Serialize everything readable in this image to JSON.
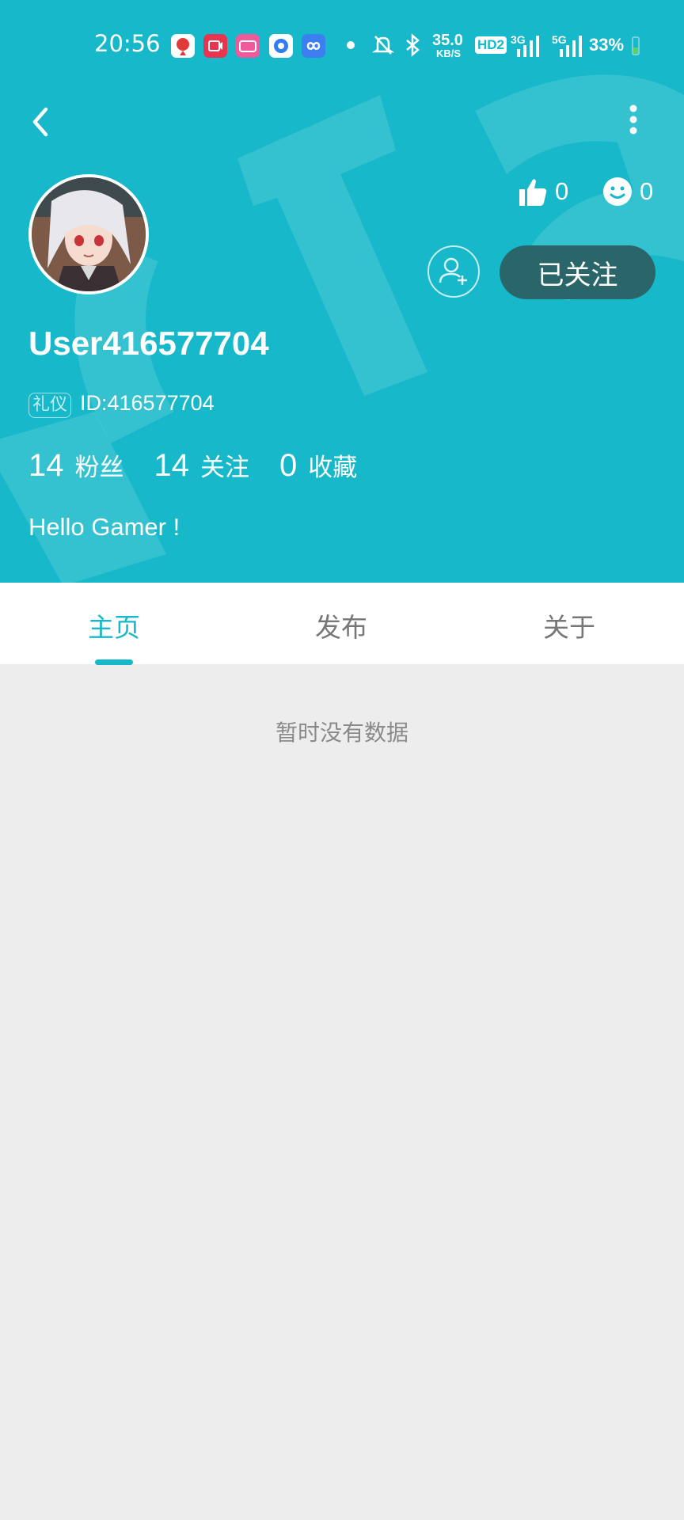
{
  "status_bar": {
    "time": "20:56",
    "speed": "35.0",
    "speed_unit": "KB/S",
    "hd": "HD2",
    "net1": "3G",
    "net2": "5G",
    "battery": "33%"
  },
  "nav": {
    "back_icon": "chevron-left-icon",
    "more_icon": "more-vertical-icon"
  },
  "profile": {
    "username": "User416577704",
    "badge": "礼仪",
    "id_text": "ID:416577704",
    "likes": "0",
    "smiles": "0",
    "follow_button": "已关注",
    "bio": "Hello Gamer !"
  },
  "stats": [
    {
      "value": "14",
      "label": "粉丝"
    },
    {
      "value": "14",
      "label": "关注"
    },
    {
      "value": "0",
      "label": "收藏"
    }
  ],
  "tabs": [
    {
      "label": "主页",
      "active": true
    },
    {
      "label": "发布",
      "active": false
    },
    {
      "label": "关于",
      "active": false
    }
  ],
  "empty_state": "暂时没有数据",
  "colors": {
    "header": "#16b8c9",
    "followed_btn": "#2a6669",
    "background": "#ededed"
  }
}
